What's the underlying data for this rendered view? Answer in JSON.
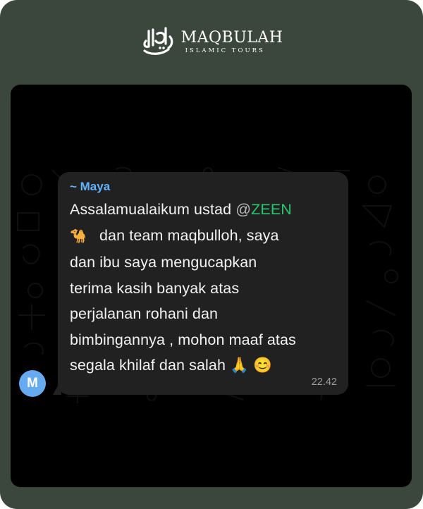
{
  "brand": {
    "name": "MAQBULAH",
    "subtitle": "ISLAMIC TOURS"
  },
  "message": {
    "sender": "~ Maya",
    "avatar_initial": "M",
    "avatar_color": "#66aaf0",
    "sender_color": "#62b3ff",
    "mention_at": "@",
    "mention_name": "ZEEN",
    "mention_color": "#28c66d",
    "lines": {
      "l1_prefix": "Assalamualaikum ustad",
      "l2_emoji": "🐪",
      "l2_text": "dan team maqbulloh, saya",
      "l3": "dan ibu saya mengucapkan",
      "l4": "terima kasih banyak atas",
      "l5": "perjalanan rohani dan",
      "l6": "bimbingannya , mohon maaf atas",
      "l7_text": "segala khilaf dan salah",
      "l7_emoji": "🙏 😊"
    },
    "time": "22.42"
  },
  "colors": {
    "frame": "#3b463c",
    "chat_background": "#000000",
    "bubble": "#212121"
  }
}
